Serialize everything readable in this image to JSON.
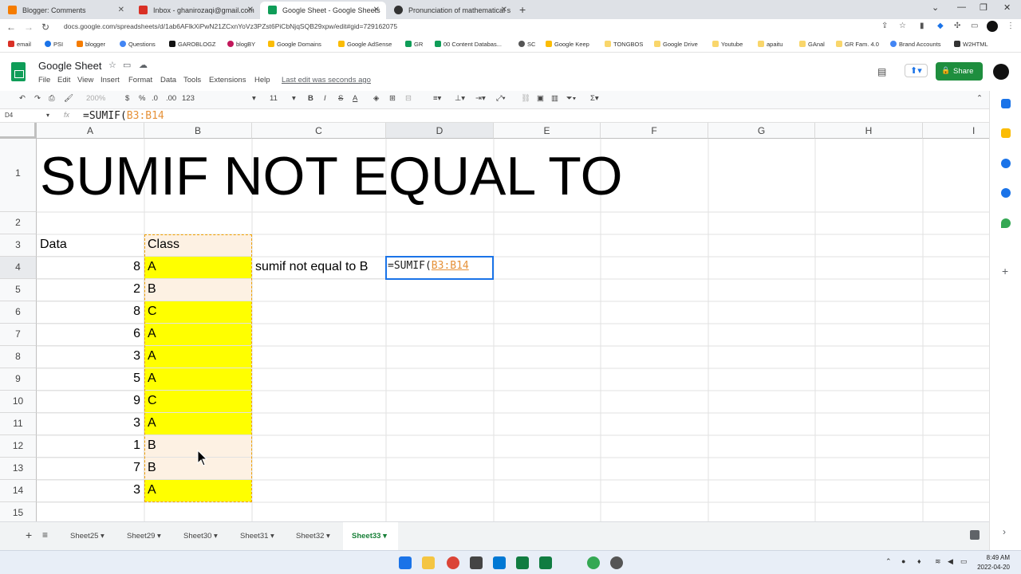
{
  "browser": {
    "tabs": [
      {
        "label": "Blogger: Comments",
        "x": 0
      },
      {
        "label": "Inbox - ghanirozaqi@gmail.com",
        "x": 1
      },
      {
        "label": "Google Sheet - Google Sheets",
        "x": 2
      },
      {
        "label": "Pronunciation of mathematical s",
        "x": 3
      }
    ],
    "url": "docs.google.com/spreadsheets/d/1ab6AFlkXiPwN21ZCxnYoVz3PZst6PiCbNjqSQB29xpw/edit#gid=729162075",
    "bookmarks": [
      "email",
      "PSI",
      "blogger",
      "Questions",
      "GAROBLOGZ",
      "blogBY",
      "Google Domains",
      "Google AdSense",
      "GR",
      "00 Content Databas...",
      "SC",
      "Google Keep",
      "TONGBOS",
      "Google Drive",
      "Youtube",
      "apaitu",
      "GAnal",
      "GR Fam. 4.0",
      "Brand Accounts",
      "W2HTML"
    ]
  },
  "sheets": {
    "title": "Google Sheet",
    "menu": [
      "File",
      "Edit",
      "View",
      "Insert",
      "Format",
      "Data",
      "Tools",
      "Extensions",
      "Help"
    ],
    "last_edit": "Last edit was seconds ago",
    "share_label": "Share",
    "toolbar": {
      "zoom": "200%",
      "currency": "$",
      "percent": "%",
      "dec_less": ".0",
      "dec_more": ".00",
      "format": "123",
      "font_size": "11",
      "bold": "B",
      "italic": "I",
      "strike": "S",
      "text_color": "A"
    },
    "name_box": "D4",
    "fx": "fx",
    "formula_prefix": "=SUMIF(",
    "formula_ref": "B3:B14"
  },
  "grid": {
    "columns": [
      "A",
      "B",
      "C",
      "D",
      "E",
      "F",
      "G",
      "H",
      "I"
    ],
    "rows": [
      "1",
      "2",
      "3",
      "4",
      "5",
      "6",
      "7",
      "8",
      "9",
      "10",
      "11",
      "12",
      "13",
      "14",
      "15"
    ],
    "title": "SUMIF NOT EQUAL TO",
    "header_data": "Data",
    "header_class": "Class",
    "data_values": [
      "8",
      "2",
      "8",
      "6",
      "3",
      "5",
      "9",
      "3",
      "1",
      "7",
      "3"
    ],
    "class_values": [
      "A",
      "B",
      "C",
      "A",
      "A",
      "A",
      "C",
      "A",
      "B",
      "B",
      "A"
    ],
    "label_c4": "sumif not equal to B",
    "active_prefix": "=SUMIF(",
    "active_ref": "B3:B14",
    "colors": {
      "yellow": "#ffff00",
      "cream": "#fdf1e3",
      "selection": "#1a73e8",
      "range": "#e69138"
    }
  },
  "sheet_tabs": [
    "Sheet25",
    "Sheet29",
    "Sheet30",
    "Sheet31",
    "Sheet32",
    "Sheet33"
  ],
  "active_sheet": "Sheet33",
  "taskbar": {
    "time": "8:49 AM",
    "date": "2022-04-20"
  }
}
